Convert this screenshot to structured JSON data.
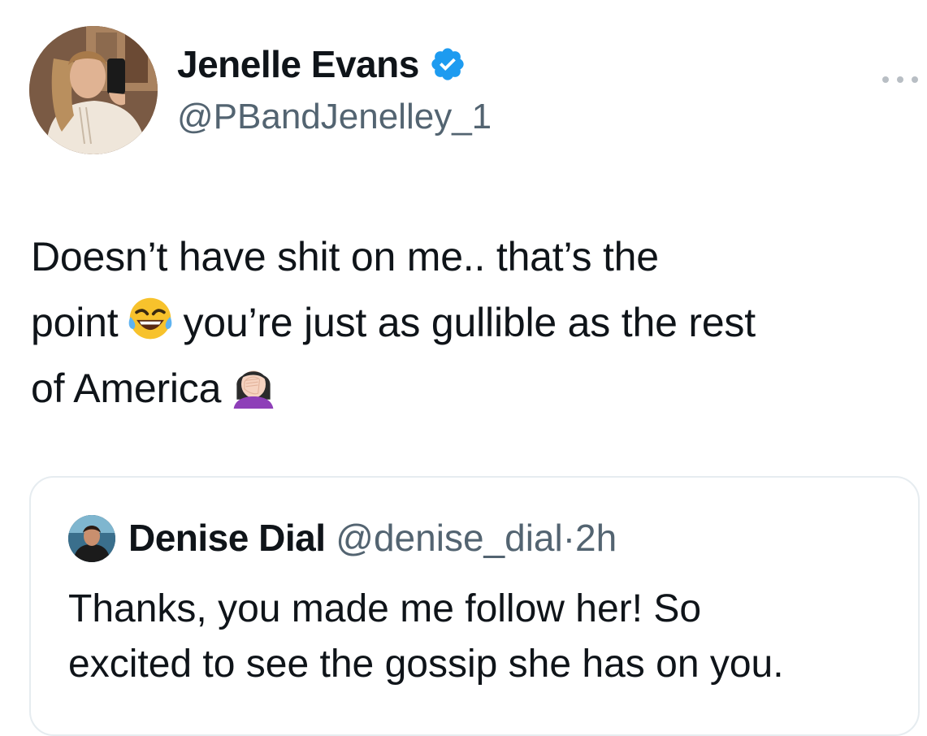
{
  "author": {
    "name": "Jenelle Evans",
    "handle": "@PBandJenelley_1",
    "verified": true,
    "verified_color": "#1d9bf0"
  },
  "tweet": {
    "line1": "Doesn’t have shit on me.. that’s the",
    "line2_a": "point",
    "line2_emoji": "face-with-tears-of-joy-icon",
    "line2_b": "you’re just as gullible as the rest",
    "line3": "of America",
    "line3_emoji": "woman-facepalming-icon"
  },
  "quoted": {
    "name": "Denise Dial",
    "handle": "@denise_dial",
    "separator": "·",
    "time": "2h",
    "text_line1": "Thanks, you made me follow her! So",
    "text_line2": "excited to see the gossip she has on you."
  },
  "colors": {
    "text": "#0f1419",
    "secondary": "#536471",
    "border": "#e6ecf0"
  }
}
